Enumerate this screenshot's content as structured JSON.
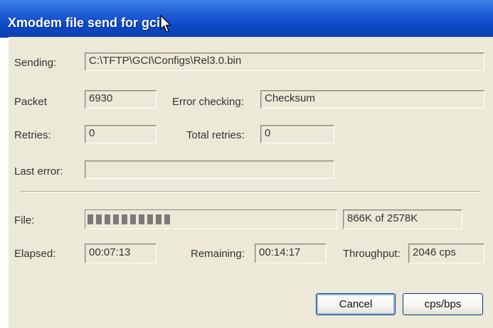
{
  "window": {
    "title": "Xmodem file send for gci"
  },
  "fields": {
    "sending_label": "Sending:",
    "sending_value": "C:\\TFTP\\GCI\\Configs\\Rel3.0.bin",
    "packet_label": "Packet",
    "packet_value": "6930",
    "error_checking_label": "Error checking:",
    "error_checking_value": "Checksum",
    "retries_label": "Retries:",
    "retries_value": "0",
    "total_retries_label": "Total retries:",
    "total_retries_value": "0",
    "last_error_label": "Last error:",
    "last_error_value": ""
  },
  "transfer": {
    "file_label": "File:",
    "progress_fraction": 0.336,
    "progress_text": "866K of 2578K",
    "elapsed_label": "Elapsed:",
    "elapsed_value": "00:07:13",
    "remaining_label": "Remaining:",
    "remaining_value": "00:14:17",
    "throughput_label": "Throughput:",
    "throughput_value": "2046 cps"
  },
  "buttons": {
    "cancel": "Cancel",
    "cps_bps": "cps/bps"
  },
  "colors": {
    "titlebar": "#0d48c4",
    "dialog_background": "#ece9d8",
    "progress_segment": "#7b7b7b"
  },
  "icons": {
    "cursor": "mouse-pointer-icon"
  }
}
